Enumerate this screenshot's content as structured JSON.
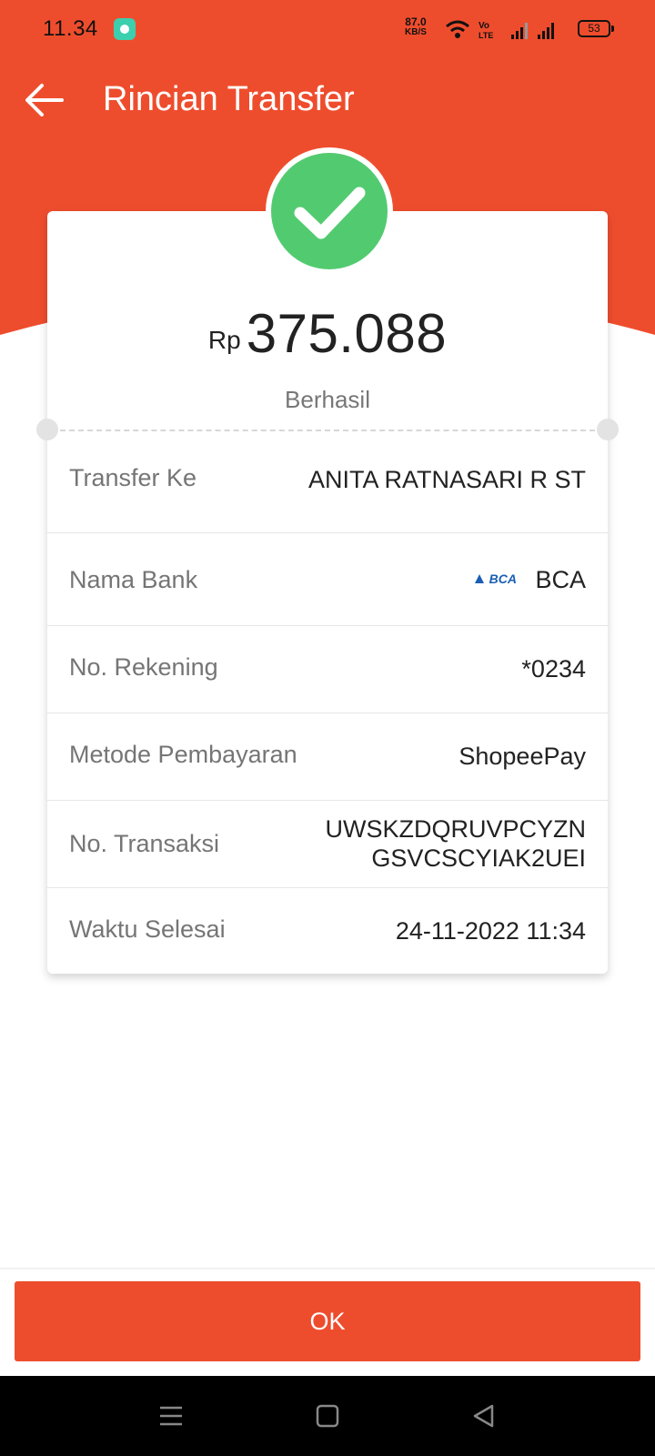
{
  "colors": {
    "brand": "#ee4d2d",
    "success": "#52cb70"
  },
  "status_bar": {
    "time": "11.34",
    "speed_value": "87.0",
    "speed_unit": "KB/S",
    "volte": "Vo LTE",
    "battery": "53"
  },
  "header": {
    "title": "Rincian Transfer",
    "back_icon": "arrow-left-icon"
  },
  "summary": {
    "icon": "check-circle-icon",
    "currency": "Rp",
    "amount": "375.088",
    "status": "Berhasil"
  },
  "details": {
    "transfer_to": {
      "label": "Transfer Ke",
      "value": "ANITA RATNASARI R ST"
    },
    "bank": {
      "label": "Nama Bank",
      "logo_text": "BCA",
      "value": "BCA"
    },
    "account": {
      "label": "No. Rekening",
      "value": "*0234"
    },
    "payment_method": {
      "label": "Metode Pembayaran",
      "value": "ShopeePay"
    },
    "transaction": {
      "label": "No. Transaksi",
      "value_line1": "UWSKZDQRUVPCYZN",
      "value_line2": "GSVCSCYIAK2UEI"
    },
    "completed_time": {
      "label": "Waktu Selesai",
      "value": "24-11-2022 11:34"
    }
  },
  "footer": {
    "ok_label": "OK"
  },
  "nav": {
    "icons": [
      "menu-icon",
      "home-square-icon",
      "back-triangle-icon"
    ]
  }
}
